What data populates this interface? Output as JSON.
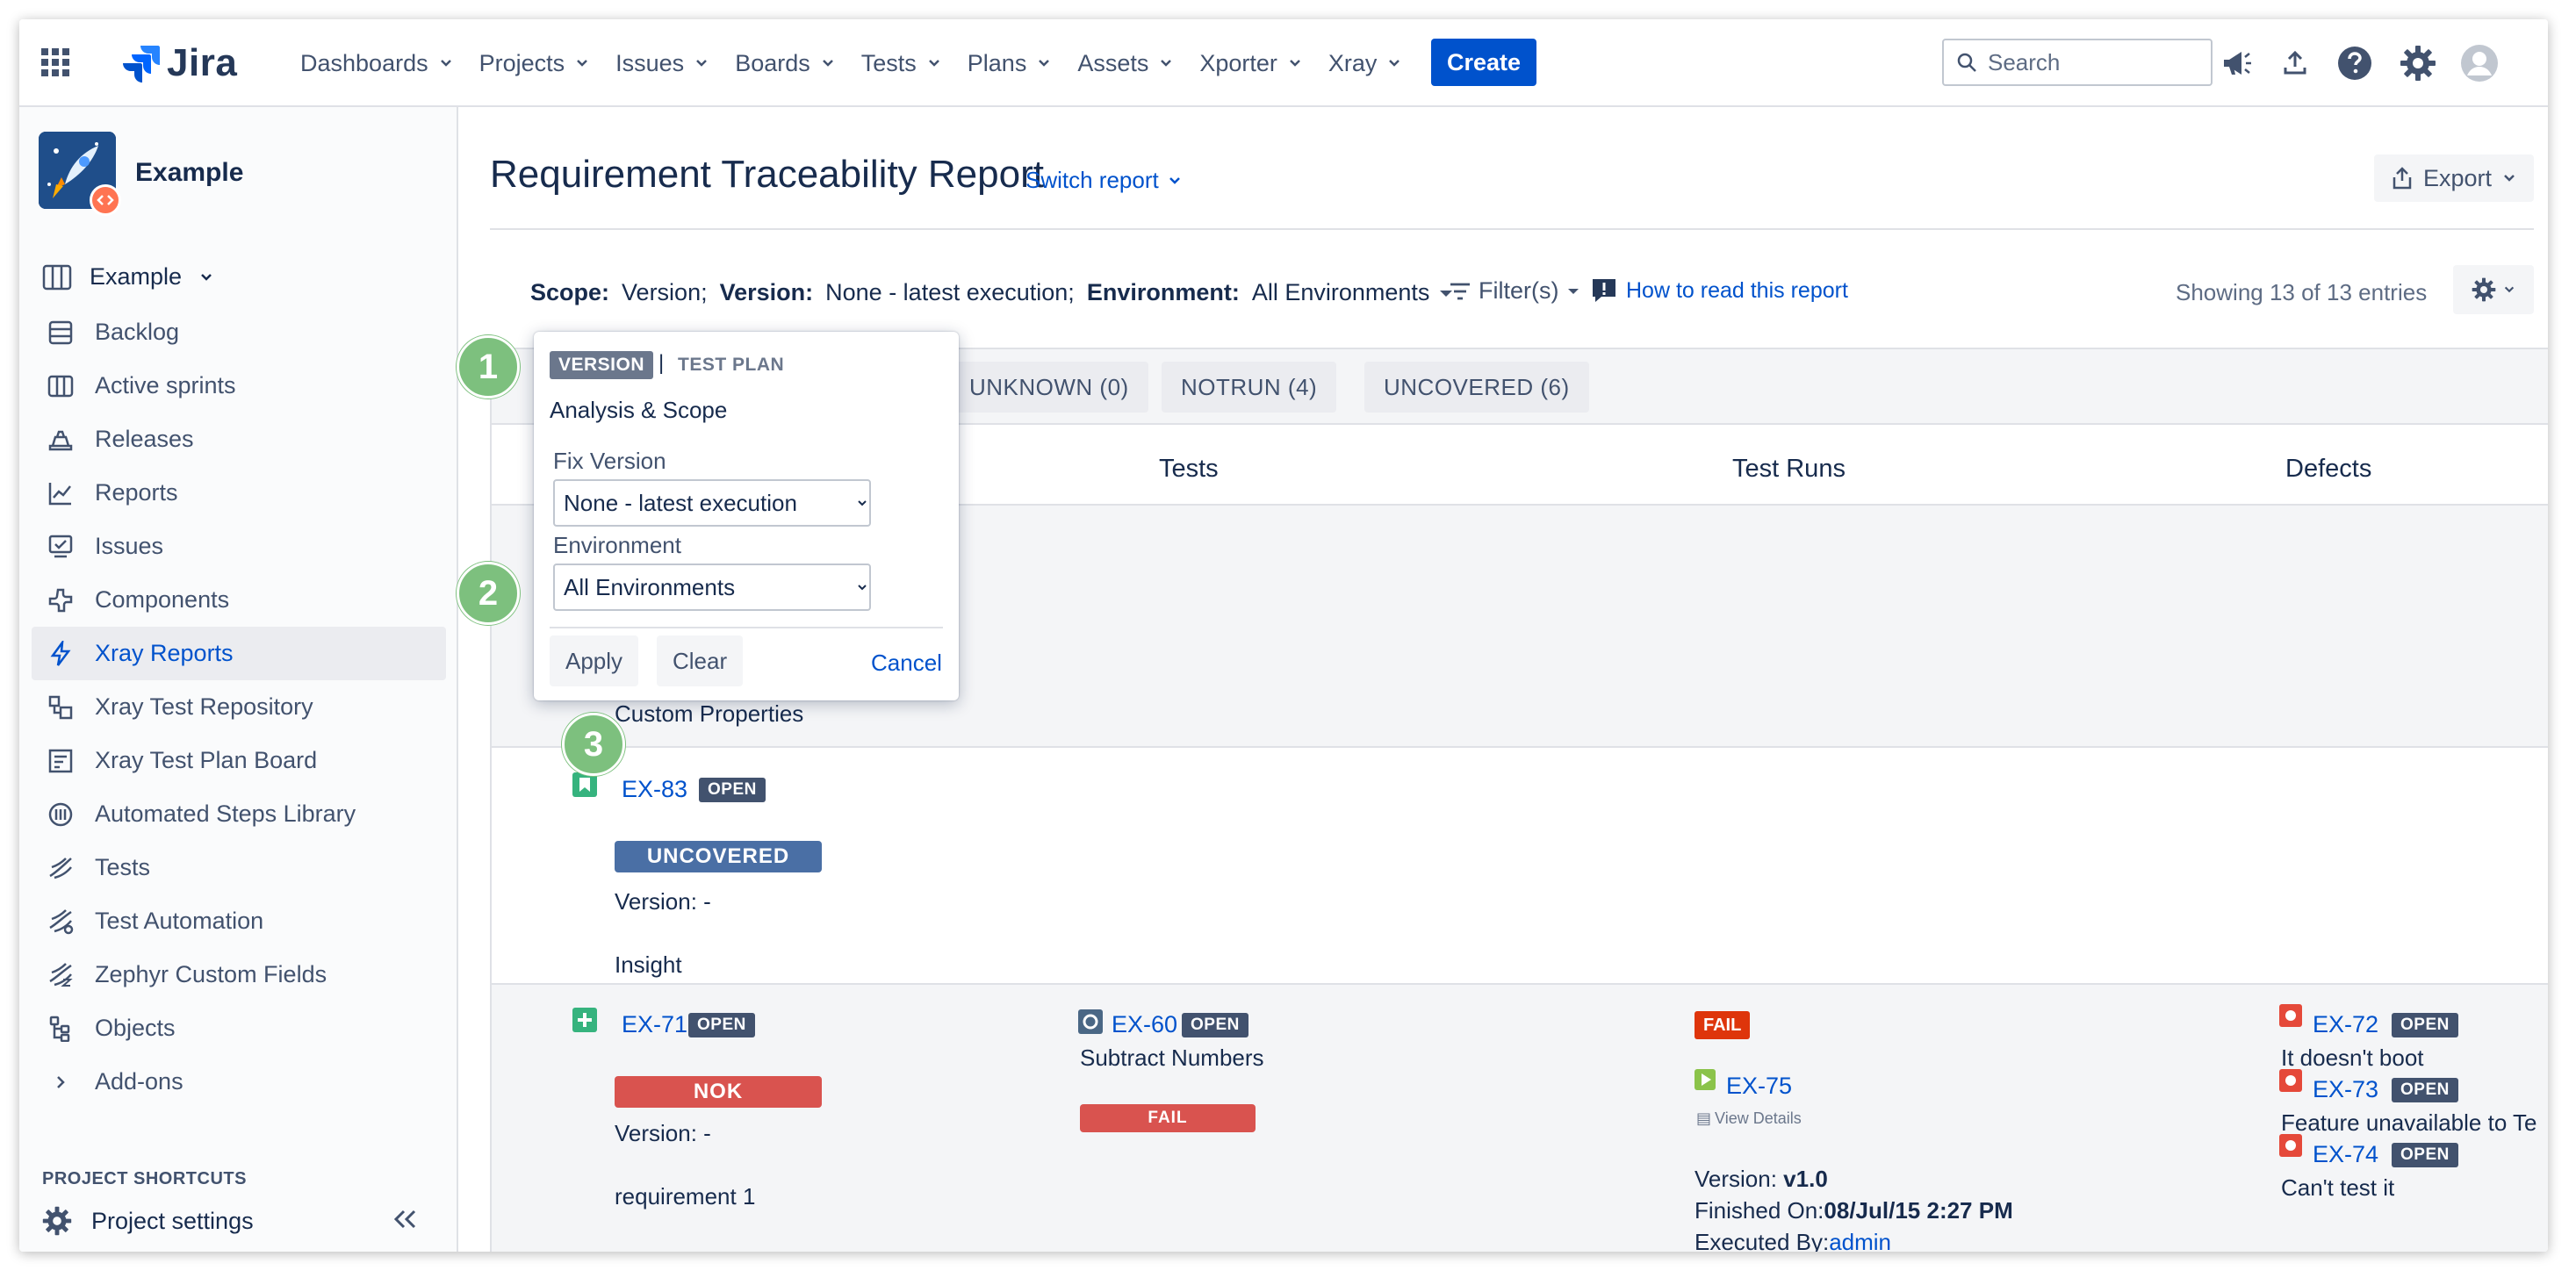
{
  "nav": {
    "logo": "Jira",
    "menu": [
      "Dashboards",
      "Projects",
      "Issues",
      "Boards",
      "Tests",
      "Plans",
      "Assets",
      "Xporter",
      "Xray"
    ],
    "create": "Create",
    "search_placeholder": "Search"
  },
  "sidebar": {
    "project_name": "Example",
    "board": "Example",
    "items": [
      {
        "label": "Backlog",
        "icon": "backlog-icon"
      },
      {
        "label": "Active sprints",
        "icon": "board-icon"
      },
      {
        "label": "Releases",
        "icon": "releases-icon"
      },
      {
        "label": "Reports",
        "icon": "reports-icon"
      },
      {
        "label": "Issues",
        "icon": "issues-icon"
      },
      {
        "label": "Components",
        "icon": "components-icon"
      },
      {
        "label": "Xray Reports",
        "icon": "xray-icon",
        "active": true
      },
      {
        "label": "Xray Test Repository",
        "icon": "repository-icon"
      },
      {
        "label": "Xray Test Plan Board",
        "icon": "plan-board-icon"
      },
      {
        "label": "Automated Steps Library",
        "icon": "library-icon"
      },
      {
        "label": "Tests",
        "icon": "tests-icon"
      },
      {
        "label": "Test Automation",
        "icon": "automation-icon"
      },
      {
        "label": "Zephyr Custom Fields",
        "icon": "zephyr-icon"
      },
      {
        "label": "Objects",
        "icon": "objects-icon"
      },
      {
        "label": "Add-ons",
        "icon": "chevron-right-icon"
      }
    ],
    "shortcuts_heading": "PROJECT SHORTCUTS",
    "settings": "Project settings"
  },
  "report": {
    "title": "Requirement Traceability Report",
    "switch": "Switch report",
    "export": "Export",
    "scope_label": "Scope:",
    "scope_value": "Version;",
    "version_label": "Version:",
    "version_value": "None - latest execution;",
    "env_label": "Environment:",
    "env_value": "All Environments",
    "filters": "Filter(s)",
    "howto": "How to read this report",
    "showing": "Showing 13 of 13 entries",
    "tabs": [
      "UNKNOWN (0)",
      "NOTRUN (4)",
      "UNCOVERED (6)"
    ],
    "columns": [
      "Tests",
      "Test Runs",
      "Defects"
    ]
  },
  "rows": {
    "r0": {
      "custom": "Custom Properties"
    },
    "r1": {
      "key": "EX-83",
      "status": "OPEN",
      "coverage": "UNCOVERED",
      "version": "Version: -",
      "summary": "Insight"
    },
    "r2": {
      "key": "EX-71",
      "status": "OPEN",
      "coverage": "NOK",
      "version": "Version: -",
      "summary": "requirement 1",
      "test_key": "EX-60",
      "test_status": "OPEN",
      "test_summary": "Subtract Numbers",
      "test_result": "FAIL",
      "run_result": "FAIL",
      "run_key": "EX-75",
      "view_details": "View Details",
      "run_version_label": "Version: ",
      "run_version": "v1.0",
      "run_finished_label": "Finished On:",
      "run_finished": "08/Jul/15 2:27 PM",
      "run_executed_label": "Executed By:",
      "run_executed": "admin",
      "defects": [
        {
          "key": "EX-72",
          "status": "OPEN",
          "summary": "It doesn't boot"
        },
        {
          "key": "EX-73",
          "status": "OPEN",
          "summary": "Feature unavailable to Te"
        },
        {
          "key": "EX-74",
          "status": "OPEN",
          "summary": "Can't test it"
        }
      ]
    }
  },
  "popup": {
    "tab_version": "VERSION",
    "tab_sep": "|",
    "tab_plan": "TEST PLAN",
    "title": "Analysis & Scope",
    "fix_version_label": "Fix Version",
    "fix_version_value": "None - latest execution",
    "environment_label": "Environment",
    "environment_value": "All Environments",
    "apply": "Apply",
    "clear": "Clear",
    "cancel": "Cancel"
  },
  "steps": [
    "1",
    "2",
    "3"
  ],
  "colors": {
    "brand": "#0052cc",
    "uncovered": "#4a6fa5",
    "nok": "#d9534f",
    "fail": "#de350b",
    "step_badge": "#7dc07e"
  }
}
